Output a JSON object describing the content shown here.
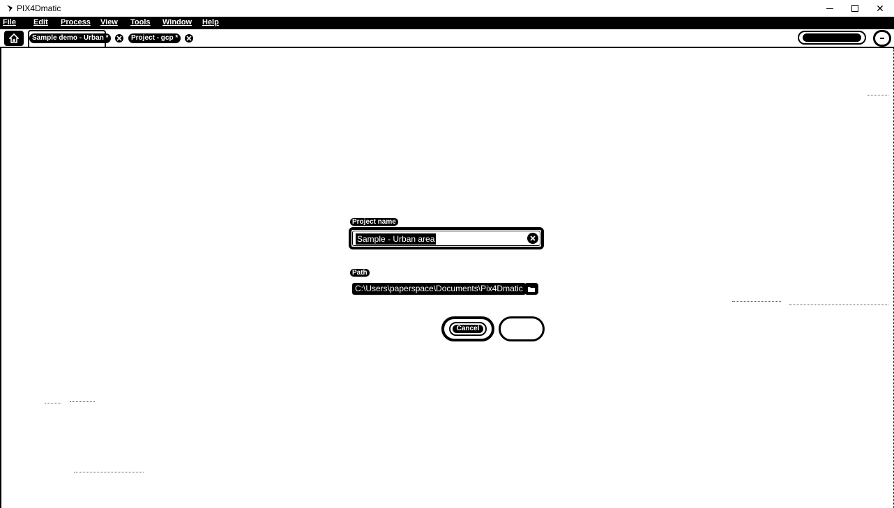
{
  "window": {
    "title": "PIX4Dmatic",
    "controls": {
      "minimize": "minimize",
      "maximize": "maximize",
      "close": "✕"
    }
  },
  "menu": {
    "items": [
      {
        "label": "File"
      },
      {
        "label": "Edit"
      },
      {
        "label": "Process"
      },
      {
        "label": "View"
      },
      {
        "label": "Tools"
      },
      {
        "label": "Window"
      },
      {
        "label": "Help"
      }
    ]
  },
  "tabs": {
    "home_icon": "home-icon",
    "items": [
      {
        "label": "Sample demo - Urban *",
        "close_icon": "close-icon"
      },
      {
        "label": "Project - gcp *",
        "close_icon": "close-icon"
      }
    ]
  },
  "header_right": {
    "license_icon": "license-pill",
    "user_icon": "user-icon"
  },
  "form": {
    "project_name_label": "Project name",
    "project_name_value": "Sample - Urban area",
    "path_label": "Path",
    "path_value": "C:\\Users\\paperspace\\Documents\\Pix4Dmatic",
    "cancel_label": "Cancel",
    "ok_label": ""
  },
  "colors": {
    "foreground": "#000000",
    "background": "#ffffff"
  }
}
